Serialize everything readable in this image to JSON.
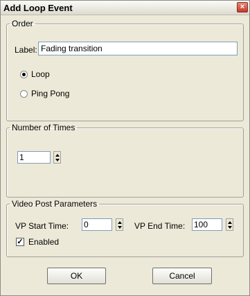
{
  "window": {
    "title": "Add Loop Event",
    "close_glyph": "×"
  },
  "order": {
    "legend": "Order",
    "label_caption": "Label:",
    "label_value": "Fading transition",
    "options": [
      {
        "label": "Loop",
        "selected": true
      },
      {
        "label": "Ping Pong",
        "selected": false
      }
    ]
  },
  "number_of_times": {
    "legend": "Number of Times",
    "value": "1"
  },
  "video_post": {
    "legend": "Video Post Parameters",
    "start_label": "VP Start Time:",
    "start_value": "0",
    "end_label": "VP End Time:",
    "end_value": "100",
    "enabled_label": "Enabled",
    "enabled_checked": true,
    "check_glyph": "✓"
  },
  "buttons": {
    "ok": "OK",
    "cancel": "Cancel"
  }
}
